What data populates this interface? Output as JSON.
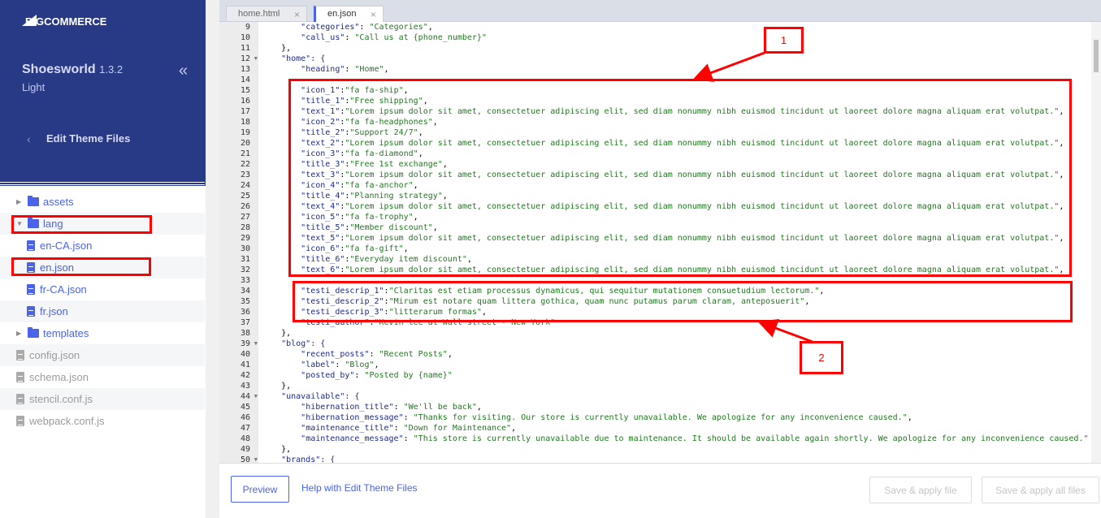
{
  "sidebar": {
    "logo": "BIGCOMMERCE",
    "theme_name": "Shoesworld",
    "theme_version": "1.3.2",
    "theme_variant": "Light",
    "collapse_icon": "«",
    "back_icon": "‹",
    "section_title": "Edit Theme Files",
    "tree": [
      {
        "label": "assets",
        "type": "folder",
        "expanded": false
      },
      {
        "label": "lang",
        "type": "folder",
        "expanded": true
      },
      {
        "label": "en-CA.json",
        "type": "file"
      },
      {
        "label": "en.json",
        "type": "file",
        "selected": true
      },
      {
        "label": "fr-CA.json",
        "type": "file"
      },
      {
        "label": "fr.json",
        "type": "file"
      },
      {
        "label": "templates",
        "type": "folder",
        "expanded": false
      },
      {
        "label": "config.json",
        "type": "file-root"
      },
      {
        "label": "schema.json",
        "type": "file-root"
      },
      {
        "label": "stencil.conf.js",
        "type": "file-root"
      },
      {
        "label": "webpack.conf.js",
        "type": "file-root"
      }
    ]
  },
  "tabs": [
    {
      "label": "home.html",
      "close": "×"
    },
    {
      "label": "en.json",
      "close": "×",
      "active": true
    }
  ],
  "editor": {
    "lines": [
      {
        "n": "9",
        "t": "        \"categories\": \"Categories\","
      },
      {
        "n": "10",
        "t": "        \"call_us\": \"Call us at {phone_number}\""
      },
      {
        "n": "11",
        "t": "    },"
      },
      {
        "n": "12",
        "t": "    \"home\": {",
        "fold": true
      },
      {
        "n": "13",
        "t": "        \"heading\": \"Home\","
      },
      {
        "n": "14",
        "t": ""
      },
      {
        "n": "15",
        "t": "        \"icon_1\":\"fa fa-ship\","
      },
      {
        "n": "16",
        "t": "        \"title_1\":\"Free shipping\","
      },
      {
        "n": "17",
        "t": "        \"text_1\":\"Lorem ipsum dolor sit amet, consectetuer adipiscing elit, sed diam nonummy nibh euismod tincidunt ut laoreet dolore magna aliquam erat volutpat.\","
      },
      {
        "n": "18",
        "t": "        \"icon_2\":\"fa fa-headphones\","
      },
      {
        "n": "19",
        "t": "        \"title_2\":\"Support 24/7\","
      },
      {
        "n": "20",
        "t": "        \"text_2\":\"Lorem ipsum dolor sit amet, consectetuer adipiscing elit, sed diam nonummy nibh euismod tincidunt ut laoreet dolore magna aliquam erat volutpat.\","
      },
      {
        "n": "21",
        "t": "        \"icon_3\":\"fa fa-diamond\","
      },
      {
        "n": "22",
        "t": "        \"title_3\":\"Free 1st exchange\","
      },
      {
        "n": "23",
        "t": "        \"text_3\":\"Lorem ipsum dolor sit amet, consectetuer adipiscing elit, sed diam nonummy nibh euismod tincidunt ut laoreet dolore magna aliquam erat volutpat.\","
      },
      {
        "n": "24",
        "t": "        \"icon_4\":\"fa fa-anchor\","
      },
      {
        "n": "25",
        "t": "        \"title_4\":\"Planning strategy\","
      },
      {
        "n": "26",
        "t": "        \"text_4\":\"Lorem ipsum dolor sit amet, consectetuer adipiscing elit, sed diam nonummy nibh euismod tincidunt ut laoreet dolore magna aliquam erat volutpat.\","
      },
      {
        "n": "27",
        "t": "        \"icon_5\":\"fa fa-trophy\","
      },
      {
        "n": "28",
        "t": "        \"title_5\":\"Member discount\","
      },
      {
        "n": "29",
        "t": "        \"text_5\":\"Lorem ipsum dolor sit amet, consectetuer adipiscing elit, sed diam nonummy nibh euismod tincidunt ut laoreet dolore magna aliquam erat volutpat.\","
      },
      {
        "n": "30",
        "t": "        \"icon_6\":\"fa fa-gift\","
      },
      {
        "n": "31",
        "t": "        \"title_6\":\"Everyday item discount\","
      },
      {
        "n": "32",
        "t": "        \"text_6\":\"Lorem ipsum dolor sit amet, consectetuer adipiscing elit, sed diam nonummy nibh euismod tincidunt ut laoreet dolore magna aliquam erat volutpat.\","
      },
      {
        "n": "33",
        "t": ""
      },
      {
        "n": "34",
        "t": "        \"testi_descrip_1\":\"Claritas est etiam processus dynamicus, qui sequitur mutationem consuetudium lectorum.\","
      },
      {
        "n": "35",
        "t": "        \"testi_descrip_2\":\"Mirum est notare quam littera gothica, quam nunc putamus parum claram, anteposuerit\","
      },
      {
        "n": "36",
        "t": "        \"testi_descrip_3\":\"litterarum formas\","
      },
      {
        "n": "37",
        "t": "        \"testi_author\":\"Kevin lee at Wall street - New York\""
      },
      {
        "n": "38",
        "t": "    },"
      },
      {
        "n": "39",
        "t": "    \"blog\": {",
        "fold": true
      },
      {
        "n": "40",
        "t": "        \"recent_posts\": \"Recent Posts\","
      },
      {
        "n": "41",
        "t": "        \"label\": \"Blog\","
      },
      {
        "n": "42",
        "t": "        \"posted_by\": \"Posted by {name}\""
      },
      {
        "n": "43",
        "t": "    },"
      },
      {
        "n": "44",
        "t": "    \"unavailable\": {",
        "fold": true
      },
      {
        "n": "45",
        "t": "        \"hibernation_title\": \"We'll be back\","
      },
      {
        "n": "46",
        "t": "        \"hibernation_message\": \"Thanks for visiting. Our store is currently unavailable. We apologize for any inconvenience caused.\","
      },
      {
        "n": "47",
        "t": "        \"maintenance_title\": \"Down for Maintenance\","
      },
      {
        "n": "48",
        "t": "        \"maintenance_message\": \"This store is currently unavailable due to maintenance. It should be available again shortly. We apologize for any inconvenience caused.\""
      },
      {
        "n": "49",
        "t": "    },"
      },
      {
        "n": "50",
        "t": "    \"brands\": {",
        "fold": true
      }
    ]
  },
  "footer": {
    "preview": "Preview",
    "help": "Help with Edit Theme Files",
    "save_file": "Save & apply file",
    "save_all": "Save & apply all files"
  },
  "annotations": {
    "label_1": "1",
    "label_2": "2",
    "color": "#ff0000"
  },
  "colors": {
    "brand": "#283a85",
    "accent": "#4a63e8",
    "key": "#1d2a8e",
    "string": "#1e7a1e"
  }
}
